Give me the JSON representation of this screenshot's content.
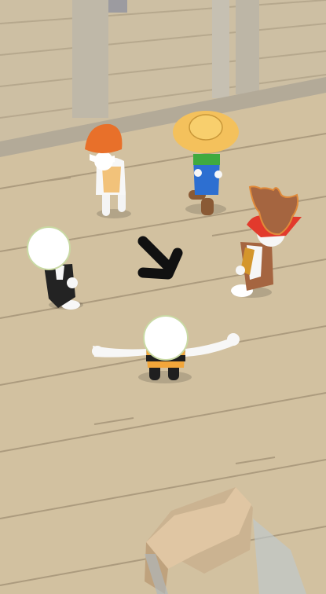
{
  "scene": {
    "type": "3d-game-view",
    "floor_color": "#d2c1a0",
    "plank_line_color": "#8e7d63",
    "wall_color": "#cdbfa3"
  },
  "characters": [
    {
      "role": "hunter",
      "hat": "red-cap",
      "color": "#e8702a"
    },
    {
      "role": "farmer",
      "hat": "straw-hat",
      "color": "#f4c15c"
    },
    {
      "role": "pirate",
      "hat": "tricorn-hat",
      "color": "#a56540"
    },
    {
      "role": "butler",
      "hat": "none",
      "color": "#222222"
    },
    {
      "role": "player",
      "hat": "none",
      "color": "#f2a63a",
      "pose": "arms-out"
    }
  ],
  "arrow": {
    "icon": "arrow-down-right-icon",
    "color": "#111111"
  },
  "object": {
    "name": "armchair",
    "color": "#e0c6a3"
  }
}
